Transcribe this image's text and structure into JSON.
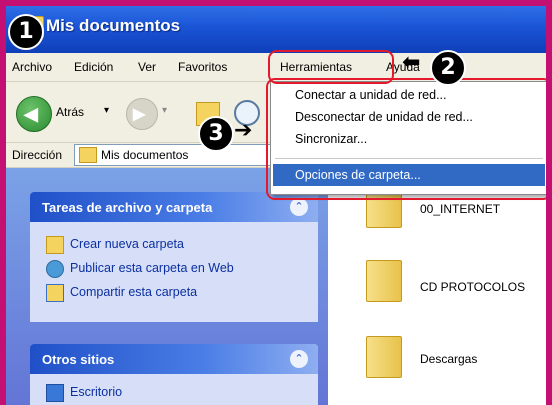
{
  "window": {
    "title": "Mis documentos"
  },
  "menubar": {
    "items": [
      "Archivo",
      "Edición",
      "Ver",
      "Favoritos",
      "Herramientas",
      "Ayuda"
    ]
  },
  "toolbar": {
    "back_label": "Atrás",
    "dropdown_glyph": "▾"
  },
  "address": {
    "label": "Dirección",
    "value": "Mis documentos"
  },
  "tools_menu": {
    "items": [
      "Conectar a unidad de red...",
      "Desconectar de unidad de red...",
      "Sincronizar...",
      "Opciones de carpeta..."
    ],
    "highlighted_index": 3
  },
  "tasks_panel": {
    "title": "Tareas de archivo y carpeta",
    "items": [
      "Crear nueva carpeta",
      "Publicar esta carpeta en Web",
      "Compartir esta carpeta"
    ]
  },
  "places_panel": {
    "title": "Otros sitios",
    "items": [
      "Escritorio"
    ]
  },
  "folders": [
    "00_INTERNET",
    "CD PROTOCOLOS",
    "Descargas"
  ],
  "annotations": {
    "markers": [
      "1",
      "2",
      "3"
    ],
    "arrow_glyph": "➔",
    "arrow_left_glyph": "⬅",
    "color": "#e31a2c"
  }
}
